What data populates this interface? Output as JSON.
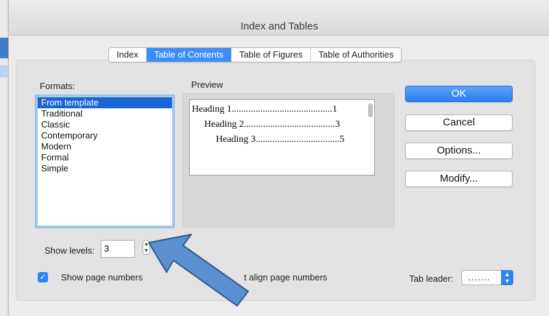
{
  "window": {
    "title": "Index and Tables"
  },
  "tabs": [
    {
      "label": "Index"
    },
    {
      "label": "Table of Contents",
      "active": true
    },
    {
      "label": "Table of Figures"
    },
    {
      "label": "Table of Authorities"
    }
  ],
  "formats": {
    "label": "Formats:",
    "items": [
      "From template",
      "Traditional",
      "Classic",
      "Contemporary",
      "Modern",
      "Formal",
      "Simple"
    ],
    "selected": "From template"
  },
  "preview": {
    "label": "Preview",
    "lines": [
      {
        "text": "Heading 1..........................................",
        "page": "1"
      },
      {
        "text": "Heading 2......................................",
        "page": "3"
      },
      {
        "text": "Heading 3...................................",
        "page": "5"
      }
    ]
  },
  "buttons": {
    "ok": "OK",
    "cancel": "Cancel",
    "options": "Options...",
    "modify": "Modify..."
  },
  "show_levels": {
    "label": "Show levels:",
    "value": "3"
  },
  "show_page_numbers": {
    "label": "Show page numbers",
    "checked": true
  },
  "right_align": {
    "label": "t align page numbers"
  },
  "tab_leader": {
    "label": "Tab leader:",
    "value": "......."
  },
  "annotation": {
    "arrow_color": "#5b8fcf",
    "arrow_stroke": "#2d5a8a"
  }
}
